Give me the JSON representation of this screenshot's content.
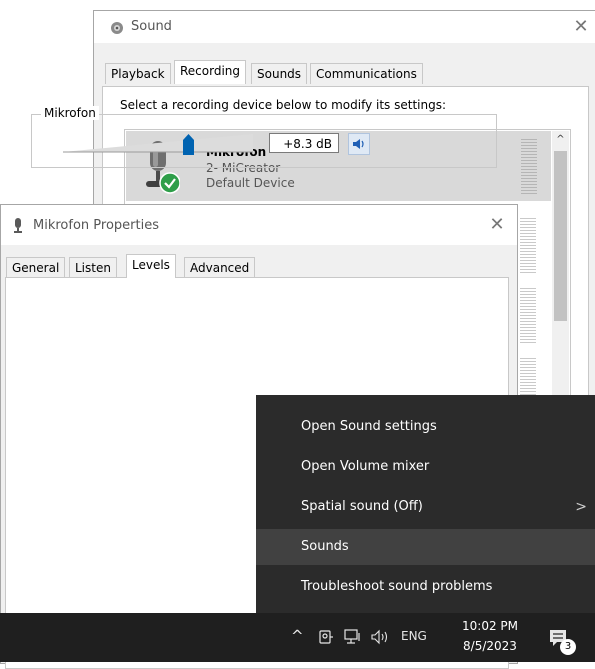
{
  "sound_window": {
    "title": "Sound",
    "close_glyph": "✕",
    "tabs": [
      "Playback",
      "Recording",
      "Sounds",
      "Communications"
    ],
    "active_tab": "Recording",
    "instruction": "Select a recording device below to modify its settings:",
    "device": {
      "name": "Mikrofon",
      "subtitle": "2- MiCreator",
      "status": "Default Device",
      "status_icon": "green-check-icon"
    },
    "scroll_up_glyph": "^"
  },
  "properties_window": {
    "title": "Mikrofon Properties",
    "close_glyph": "✕",
    "tabs": [
      "General",
      "Listen",
      "Levels",
      "Advanced"
    ],
    "active_tab": "Levels",
    "level_group_label": "Mikrofon",
    "level_value": "+8.3 dB",
    "slider_level_fraction": 0.66,
    "mute_icon": "speaker-icon"
  },
  "context_menu": {
    "items": [
      {
        "label": "Open Sound settings"
      },
      {
        "label": "Open Volume mixer"
      },
      {
        "label": "Spatial sound (Off)",
        "submenu_glyph": ">"
      },
      {
        "label": "Sounds"
      },
      {
        "label": "Troubleshoot sound problems"
      }
    ],
    "hovered_item": "Sounds"
  },
  "taskbar": {
    "chevron_glyph": "^",
    "tray_icons": [
      "people-icon",
      "network-icon",
      "volume-icon"
    ],
    "language": "ENG",
    "time": "10:02 PM",
    "date": "8/5/2023",
    "notification_count": "3",
    "notification_icon": "action-center-icon"
  },
  "colors": {
    "menu_bg": "#2b2b2b",
    "menu_hover": "#414141",
    "taskbar_bg": "#1f1f1f",
    "slider_accent": "#0063b1",
    "check_green": "#2e9e49"
  }
}
